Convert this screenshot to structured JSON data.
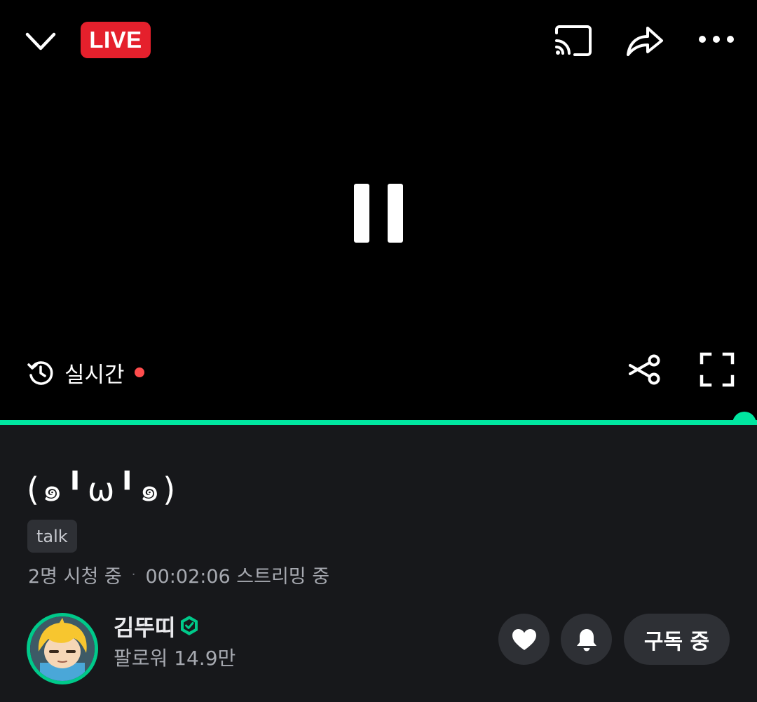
{
  "player": {
    "live_badge": "LIVE",
    "realtime_label": "실시간",
    "progress_fraction": 1.0,
    "colors": {
      "accent": "#00e6a0",
      "live_red": "#e5202c",
      "live_dot": "#ff4d4d"
    }
  },
  "stream": {
    "title": "(๑╹ω╹๑)",
    "tag": "talk",
    "viewers": "2명 시청 중",
    "separator": "·",
    "stream_time": "00:02:06 스트리밍 중"
  },
  "channel": {
    "name": "김뚜띠",
    "followers": "팔로워 14.9만",
    "subscribe_label": "구독 중"
  },
  "icons": {
    "collapse": "chevron-down-icon",
    "cast": "cast-icon",
    "share": "share-icon",
    "more": "more-icon",
    "realtime": "history-icon",
    "clip": "scissors-icon",
    "fullscreen": "fullscreen-icon",
    "verified": "verified-badge-icon",
    "like": "heart-icon",
    "notify": "bell-icon"
  }
}
